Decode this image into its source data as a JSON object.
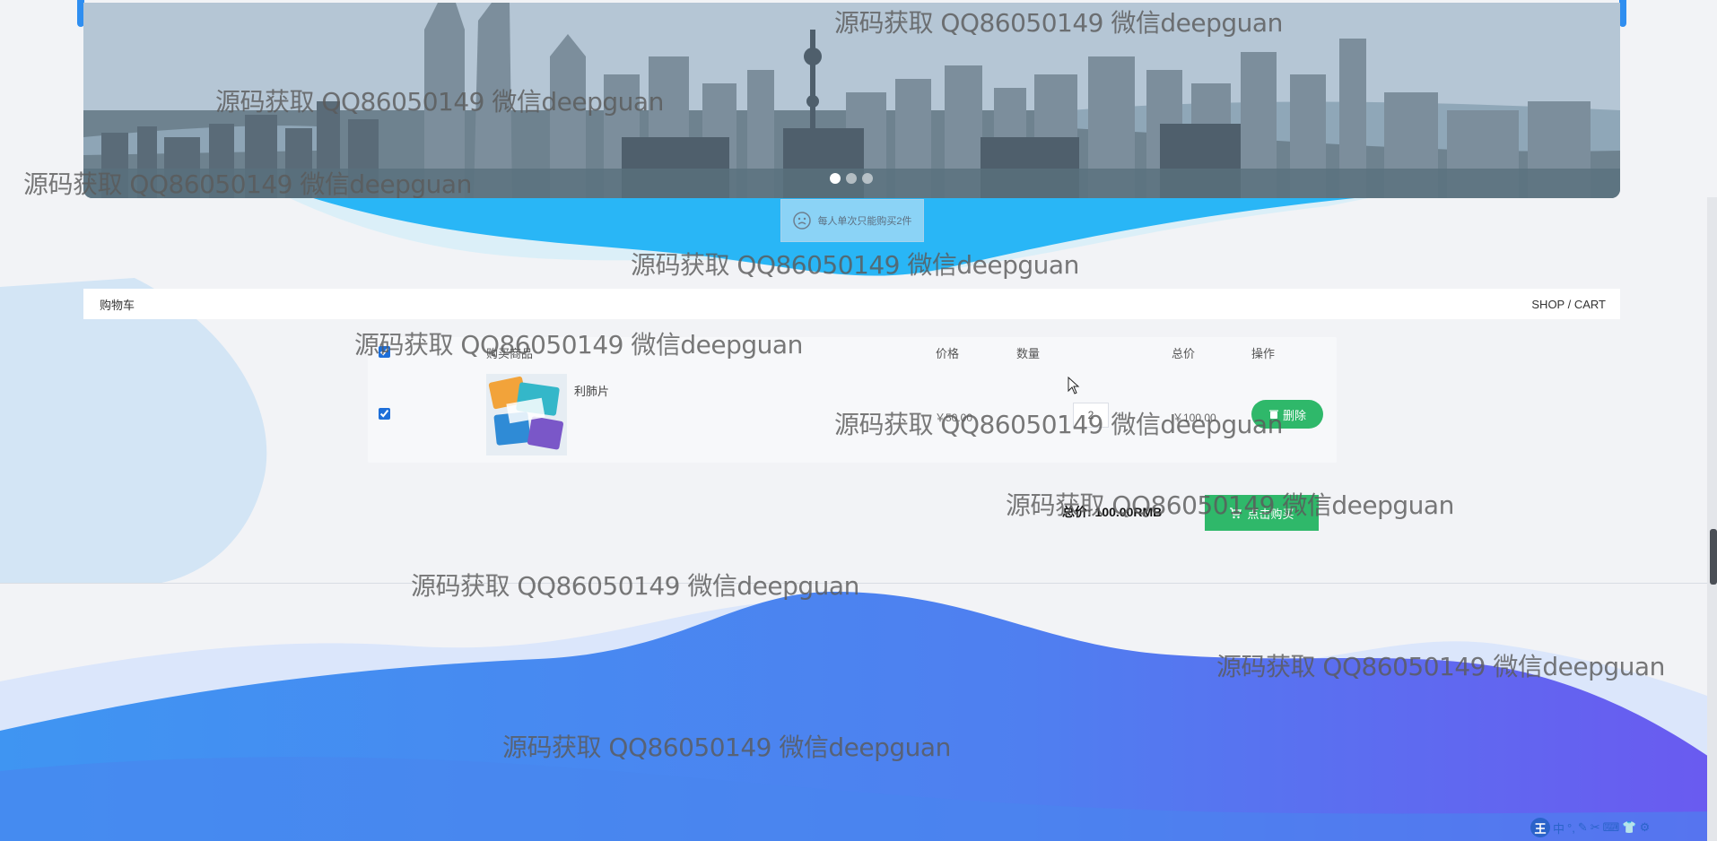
{
  "watermark": "源码获取 QQ86050149 微信deepguan",
  "carousel": {
    "dots": 3,
    "active_index": 0
  },
  "notice": {
    "text": "每人单次只能购买2件",
    "icon": "sad-face-icon"
  },
  "header": {
    "left_title": "购物车",
    "right_title": "SHOP / CART"
  },
  "cart": {
    "columns": {
      "product": "购买商品",
      "price": "价格",
      "qty": "数量",
      "total": "总价",
      "action": "操作"
    },
    "select_all_checked": true,
    "items": [
      {
        "name": "利肺片",
        "price": "￥50.00",
        "qty": "2",
        "minus": "-",
        "plus": "+",
        "total": "￥100.00",
        "delete_label": "删除",
        "checked": true,
        "image_icon": "product-image"
      }
    ]
  },
  "summary": {
    "total_text": "总价: 100.00RMB",
    "buy_label": "点击购买"
  },
  "ime_bar": {
    "logo": "王",
    "items": [
      "中",
      "°,",
      "✎",
      "✂",
      "⌨",
      "👕",
      "⚙"
    ]
  },
  "colors": {
    "accent_green": "#2fb86a",
    "wave_light_blue": "#29b6f6",
    "wave_blue": "#4f7ff0",
    "wave_purple": "#6a5af0"
  }
}
